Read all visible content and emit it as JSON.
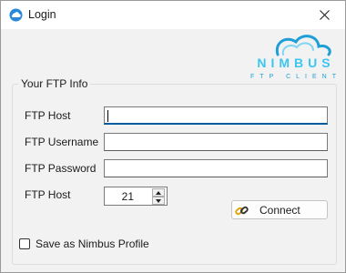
{
  "window": {
    "title": "Login"
  },
  "logo": {
    "brand": "NIMBUS",
    "tagline": "FTP CLIENT"
  },
  "group": {
    "title": "Your FTP Info"
  },
  "form": {
    "host_label": "FTP Host",
    "host_value": "",
    "username_label": "FTP Username",
    "username_value": "",
    "password_label": "FTP Password",
    "password_value": "",
    "port_label": "FTP Host",
    "port_value": "21"
  },
  "buttons": {
    "connect_label": "Connect"
  },
  "options": {
    "save_profile_label": "Save as Nimbus Profile",
    "save_profile_checked": false
  },
  "colors": {
    "accent": "#005a9e",
    "logo_blue": "#1e9fd6",
    "logo_light": "#7fd6f2"
  }
}
